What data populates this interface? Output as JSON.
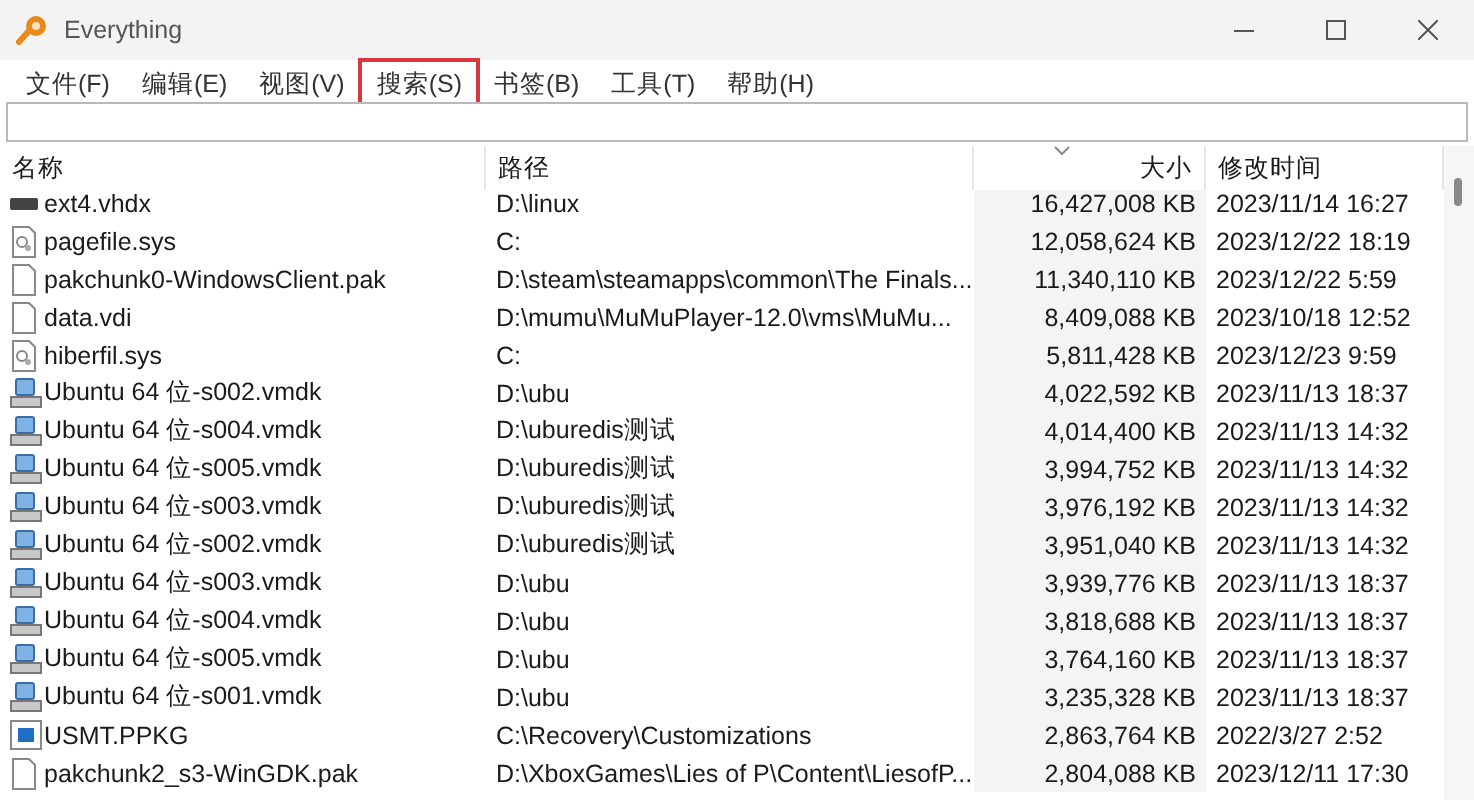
{
  "window": {
    "title": "Everything"
  },
  "menu": [
    {
      "label": "文件(F)",
      "highlighted": false
    },
    {
      "label": "编辑(E)",
      "highlighted": false
    },
    {
      "label": "视图(V)",
      "highlighted": false
    },
    {
      "label": "搜索(S)",
      "highlighted": true
    },
    {
      "label": "书签(B)",
      "highlighted": false
    },
    {
      "label": "工具(T)",
      "highlighted": false
    },
    {
      "label": "帮助(H)",
      "highlighted": false
    }
  ],
  "table": {
    "columns": [
      {
        "label": "名称",
        "sorted": false
      },
      {
        "label": "路径",
        "sorted": false
      },
      {
        "label": "大小",
        "sorted": true
      },
      {
        "label": "修改时间",
        "sorted": false
      }
    ],
    "rows": [
      {
        "kind": "drive",
        "name": "ext4.vhdx",
        "path": "D:\\linux",
        "size": "16,427,008 KB",
        "modified": "2023/11/14 16:27"
      },
      {
        "kind": "system",
        "name": "pagefile.sys",
        "path": "C:",
        "size": "12,058,624 KB",
        "modified": "2023/12/22 18:19"
      },
      {
        "kind": "file",
        "name": "pakchunk0-WindowsClient.pak",
        "path": "D:\\steam\\steamapps\\common\\The Finals...",
        "size": "11,340,110 KB",
        "modified": "2023/12/22 5:59"
      },
      {
        "kind": "file",
        "name": "data.vdi",
        "path": "D:\\mumu\\MuMuPlayer-12.0\\vms\\MuMu...",
        "size": "8,409,088 KB",
        "modified": "2023/10/18 12:52"
      },
      {
        "kind": "system",
        "name": "hiberfil.sys",
        "path": "C:",
        "size": "5,811,428 KB",
        "modified": "2023/12/23 9:59"
      },
      {
        "kind": "vm",
        "name": "Ubuntu 64 位-s002.vmdk",
        "path": "D:\\ubu",
        "size": "4,022,592 KB",
        "modified": "2023/11/13 18:37"
      },
      {
        "kind": "vm",
        "name": "Ubuntu 64 位-s004.vmdk",
        "path": "D:\\uburedis测试",
        "size": "4,014,400 KB",
        "modified": "2023/11/13 14:32"
      },
      {
        "kind": "vm",
        "name": "Ubuntu 64 位-s005.vmdk",
        "path": "D:\\uburedis测试",
        "size": "3,994,752 KB",
        "modified": "2023/11/13 14:32"
      },
      {
        "kind": "vm",
        "name": "Ubuntu 64 位-s003.vmdk",
        "path": "D:\\uburedis测试",
        "size": "3,976,192 KB",
        "modified": "2023/11/13 14:32"
      },
      {
        "kind": "vm",
        "name": "Ubuntu 64 位-s002.vmdk",
        "path": "D:\\uburedis测试",
        "size": "3,951,040 KB",
        "modified": "2023/11/13 14:32"
      },
      {
        "kind": "vm",
        "name": "Ubuntu 64 位-s003.vmdk",
        "path": "D:\\ubu",
        "size": "3,939,776 KB",
        "modified": "2023/11/13 18:37"
      },
      {
        "kind": "vm",
        "name": "Ubuntu 64 位-s004.vmdk",
        "path": "D:\\ubu",
        "size": "3,818,688 KB",
        "modified": "2023/11/13 18:37"
      },
      {
        "kind": "vm",
        "name": "Ubuntu 64 位-s005.vmdk",
        "path": "D:\\ubu",
        "size": "3,764,160 KB",
        "modified": "2023/11/13 18:37"
      },
      {
        "kind": "vm",
        "name": "Ubuntu 64 位-s001.vmdk",
        "path": "D:\\ubu",
        "size": "3,235,328 KB",
        "modified": "2023/11/13 18:37"
      },
      {
        "kind": "package",
        "name": "USMT.PPKG",
        "path": "C:\\Recovery\\Customizations",
        "size": "2,863,764 KB",
        "modified": "2022/3/27 2:52"
      },
      {
        "kind": "file",
        "name": "pakchunk2_s3-WinGDK.pak",
        "path": "D:\\XboxGames\\Lies of P\\Content\\LiesofP...",
        "size": "2,804,088 KB",
        "modified": "2023/12/11 17:30"
      }
    ]
  }
}
